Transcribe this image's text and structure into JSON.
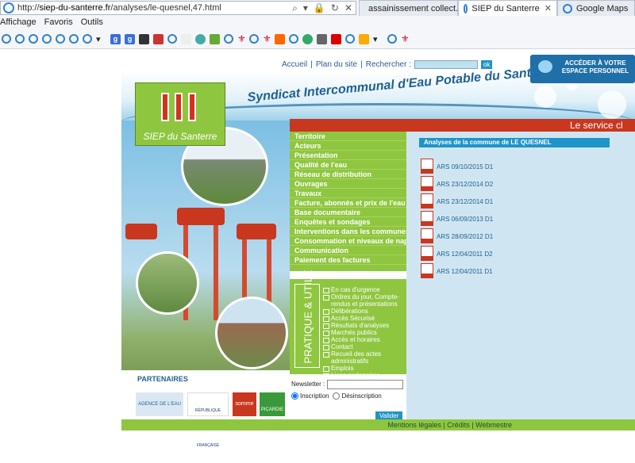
{
  "browser": {
    "url_prefix": "http://",
    "url_host": "siep-du-santerre.fr",
    "url_path": "/analyses/le-quesnel,47.html",
    "tabs": [
      {
        "label": "assainissement collect..."
      },
      {
        "label": "SIEP du Santerre"
      },
      {
        "label": "Google Maps"
      }
    ],
    "menu": [
      "Affichage",
      "Favoris",
      "Outils"
    ]
  },
  "header": {
    "nav": [
      "Accueil",
      "Plan du site",
      "Rechercher :"
    ],
    "ok": "ok",
    "espace": "ACCÉDER À VOTRE ESPACE PERSONNEL",
    "site_title": "Syndicat Intercommunal d'Eau Potable du Santerre",
    "logo_name": "SIEP du Santerre"
  },
  "menu": [
    "Territoire",
    "Acteurs",
    "Présentation",
    "Qualité de l'eau",
    "Réseau de distribution",
    "Ouvrages",
    "Travaux",
    "Facture, abonnés et prix de l'eau",
    "Base documentaire",
    "Enquêtes et sondages",
    "Interventions dans les communes",
    "Consommation et niveaux de nappe",
    "Communication",
    "Paiement des factures"
  ],
  "pratique": {
    "title": "PRATIQUE & UTILE",
    "items": [
      "En cas d'urgence",
      "Ordres du jour, Compte-rendus et présentations",
      "Délibérations",
      "Accès Sécurisé",
      "Résultats d'analyses",
      "Marchés publics",
      "Accès et horaires",
      "Contact",
      "Recueil des actes administratifs",
      "Emplois",
      "Liens partenaires"
    ]
  },
  "newsletter": {
    "label": "Newsletter :",
    "inscription": "Inscription",
    "desinscription": "Désinscription",
    "valider": "Valider"
  },
  "partners": {
    "label": "PARTENAIRES",
    "logos": [
      "AGENCE DE L'EAU",
      "RÉPUBLIQUE FRANÇAISE",
      "somme",
      "PICARDIE"
    ]
  },
  "marquee": "Le service cl",
  "analyses": {
    "heading": "Analyses de la commune de LE QUESNEL",
    "items": [
      "ARS 09/10/2015 D1",
      "ARS 23/12/2014 D2",
      "ARS 23/12/2014 D1",
      "ARS 06/09/2013 D1",
      "ARS 28/09/2012 D1",
      "ARS 12/04/2011 D2",
      "ARS 12/04/2011 D1"
    ]
  },
  "footer": {
    "links": [
      "Mentions légales",
      "Crédits",
      "Webmestre"
    ]
  }
}
